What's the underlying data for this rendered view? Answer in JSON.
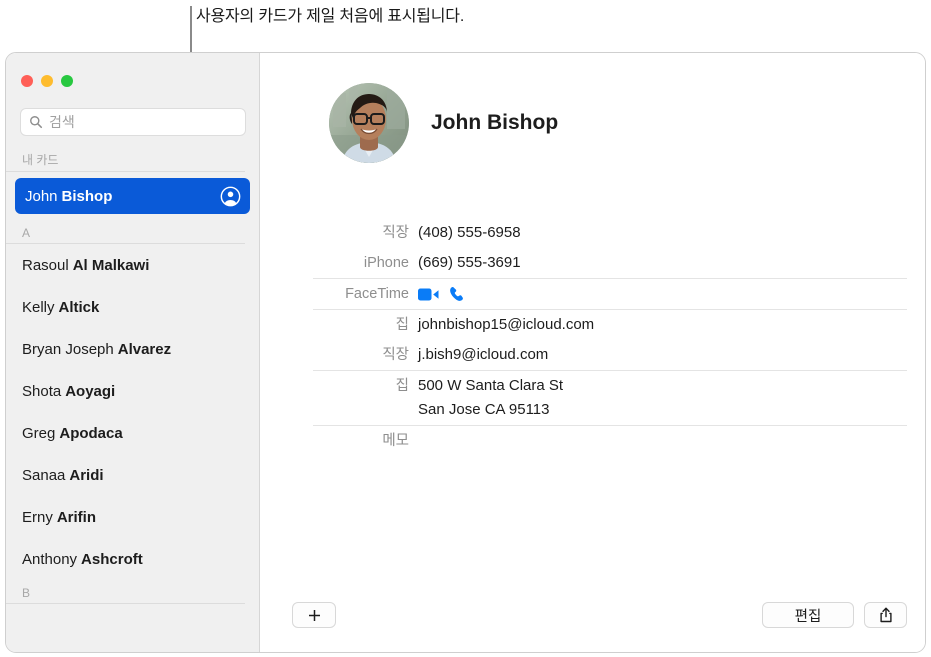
{
  "callout": {
    "text": "사용자의 카드가 제일 처음에 표시됩니다."
  },
  "window": {
    "traffic_lights": [
      {
        "name": "close",
        "color": "#ff5f57"
      },
      {
        "name": "minimize",
        "color": "#febc2e"
      },
      {
        "name": "zoom",
        "color": "#28c840"
      }
    ]
  },
  "sidebar": {
    "search": {
      "placeholder": "검색",
      "value": "",
      "icon": "search-icon"
    },
    "sections": [
      {
        "header": "내 카드",
        "contacts": [
          {
            "first": "John",
            "last": "Bishop",
            "selected": true,
            "badge": "my-card-icon"
          }
        ]
      },
      {
        "header": "A",
        "contacts": [
          {
            "first": "Rasoul",
            "last": "Al Malkawi",
            "selected": false
          },
          {
            "first": "Kelly",
            "last": "Altick",
            "selected": false
          },
          {
            "first": "Bryan Joseph",
            "last": "Alvarez",
            "selected": false
          },
          {
            "first": "Shota",
            "last": "Aoyagi",
            "selected": false
          },
          {
            "first": "Greg",
            "last": "Apodaca",
            "selected": false
          },
          {
            "first": "Sanaa",
            "last": "Aridi",
            "selected": false
          },
          {
            "first": "Erny",
            "last": "Arifin",
            "selected": false
          },
          {
            "first": "Anthony",
            "last": "Ashcroft",
            "selected": false
          }
        ]
      },
      {
        "header": "B",
        "contacts": []
      }
    ],
    "selection_color": "#0a5ad8"
  },
  "detail": {
    "name": "John Bishop",
    "avatar_alt": "John Bishop 사진",
    "groups": [
      {
        "rows": [
          {
            "label": "직장",
            "value": "(408) 555-6958",
            "type": "phone"
          },
          {
            "label": "iPhone",
            "value": "(669) 555-3691",
            "type": "phone"
          }
        ]
      },
      {
        "rows": [
          {
            "label": "FaceTime",
            "value": "",
            "type": "facetime",
            "icons": [
              "facetime-video-icon",
              "facetime-audio-icon"
            ],
            "icon_color": "#0a7cf7"
          }
        ]
      },
      {
        "rows": [
          {
            "label": "집",
            "value": "johnbishop15@icloud.com",
            "type": "email"
          },
          {
            "label": "직장",
            "value": "j.bish9@icloud.com",
            "type": "email"
          }
        ]
      },
      {
        "rows": [
          {
            "label": "집",
            "type": "address",
            "lines": [
              "500 W Santa Clara St",
              "San Jose CA 95113"
            ]
          }
        ]
      },
      {
        "rows": [
          {
            "label": "메모",
            "value": "",
            "type": "notes"
          }
        ]
      }
    ]
  },
  "bottom_bar": {
    "add_label": "+",
    "add_icon": "plus-icon",
    "edit_label": "편집",
    "share_icon": "share-icon"
  }
}
